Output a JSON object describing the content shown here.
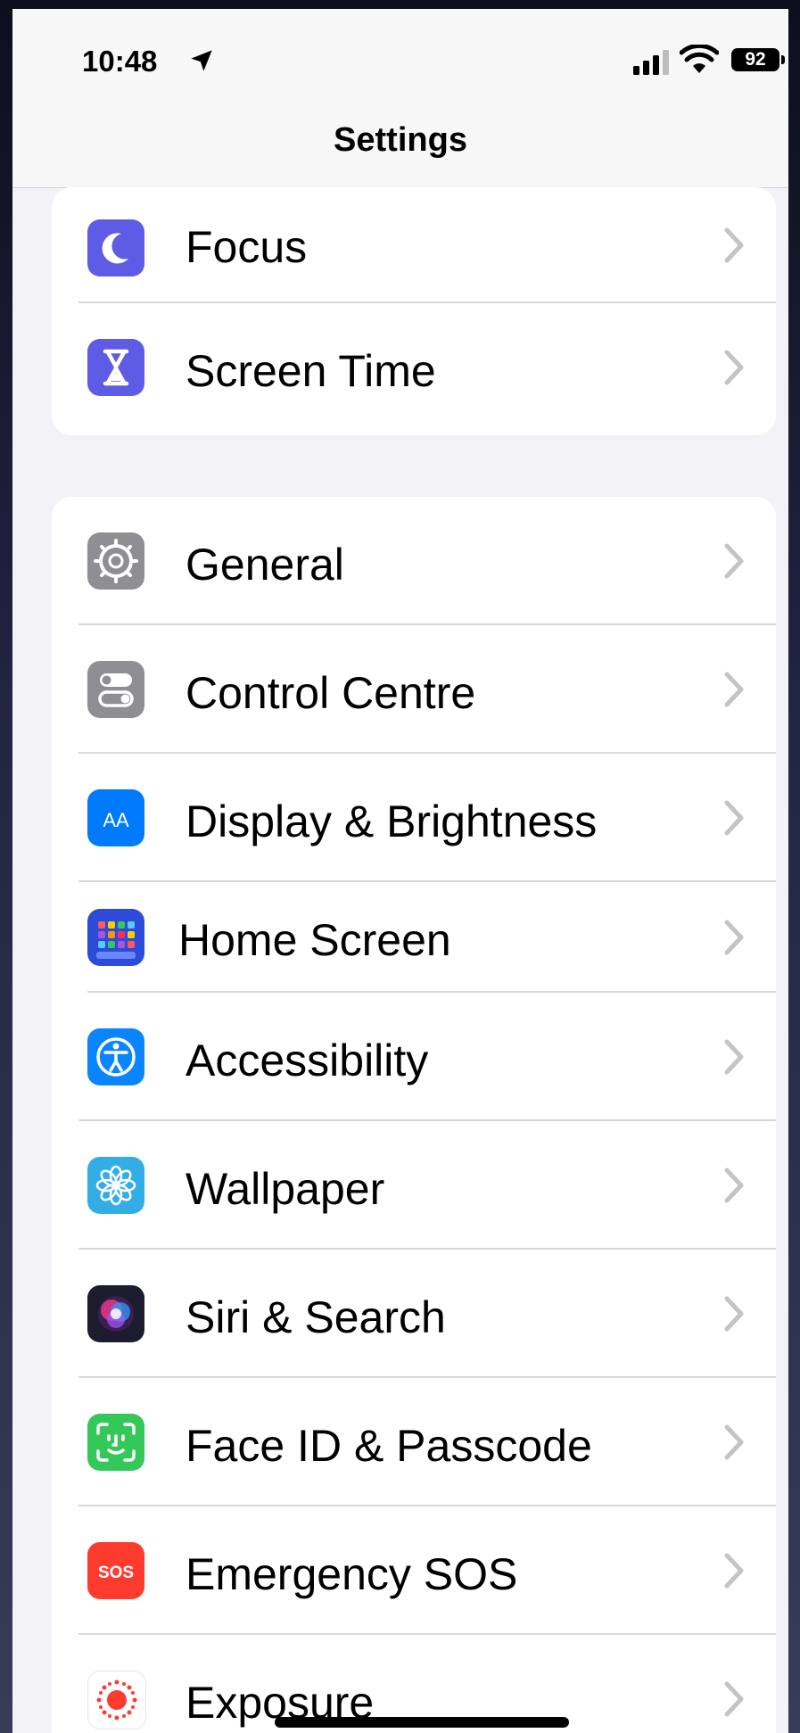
{
  "status_bar": {
    "time": "10:48",
    "battery": "92"
  },
  "nav": {
    "title": "Settings"
  },
  "groups": [
    {
      "items": [
        {
          "label": "Focus",
          "icon": "moon-icon",
          "color": "#5e5ce6"
        },
        {
          "label": "Screen Time",
          "icon": "hourglass-icon",
          "color": "#5e5ce6"
        }
      ]
    },
    {
      "items": [
        {
          "label": "General",
          "icon": "gear-icon",
          "color": "#8e8e93"
        },
        {
          "label": "Control Centre",
          "icon": "toggles-icon",
          "color": "#8e8e93"
        },
        {
          "label": "Display & Brightness",
          "icon": "text-size-icon",
          "color": "#007aff",
          "icon_text": "AA"
        },
        {
          "label": "Home Screen",
          "icon": "home-screen-grid-icon",
          "color": "#2c4bd8"
        },
        {
          "label": "Accessibility",
          "icon": "accessibility-icon",
          "color": "#0a84ff"
        },
        {
          "label": "Wallpaper",
          "icon": "flower-icon",
          "color": "#32ade6"
        },
        {
          "label": "Siri & Search",
          "icon": "siri-icon",
          "color": "#1c1c2e"
        },
        {
          "label": "Face ID & Passcode",
          "icon": "face-id-icon",
          "color": "#34c759"
        },
        {
          "label": "Emergency SOS",
          "icon": "sos-icon",
          "color": "#ff3b30",
          "icon_text": "SOS"
        },
        {
          "label": "Exposure",
          "icon": "exposure-icon",
          "color": "#ffffff"
        }
      ]
    }
  ]
}
